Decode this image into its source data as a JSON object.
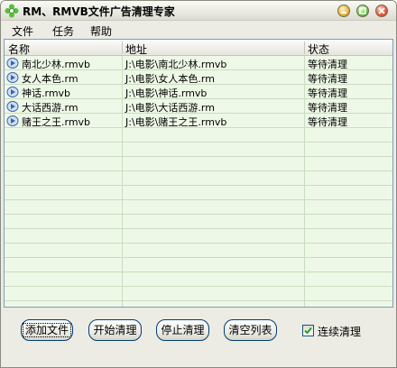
{
  "window": {
    "title": "RM、RMVB文件广告清理专家"
  },
  "menu": [
    "文件",
    "任务",
    "帮助"
  ],
  "columns": [
    "名称",
    "地址",
    "状态"
  ],
  "rows": [
    {
      "name": "南北少林.rmvb",
      "path": "J:\\电影\\南北少林.rmvb",
      "status": "等待清理"
    },
    {
      "name": "女人本色.rm",
      "path": "J:\\电影\\女人本色.rm",
      "status": "等待清理"
    },
    {
      "name": "神话.rmvb",
      "path": "J:\\电影\\神话.rmvb",
      "status": "等待清理"
    },
    {
      "name": "大话西游.rm",
      "path": "J:\\电影\\大话西游.rm",
      "status": "等待清理"
    },
    {
      "name": "赌王之王.rmvb",
      "path": "J:\\电影\\赌王之王.rmvb",
      "status": "等待清理"
    }
  ],
  "buttons": {
    "add": "添加文件",
    "start": "开始清理",
    "stop": "停止清理",
    "clear": "清空列表"
  },
  "checkbox": {
    "label": "连续清理",
    "checked": true
  },
  "colors": {
    "list_bg": "#eef8e6",
    "grid": "#c9dcc0",
    "border": "#7f9db9"
  }
}
